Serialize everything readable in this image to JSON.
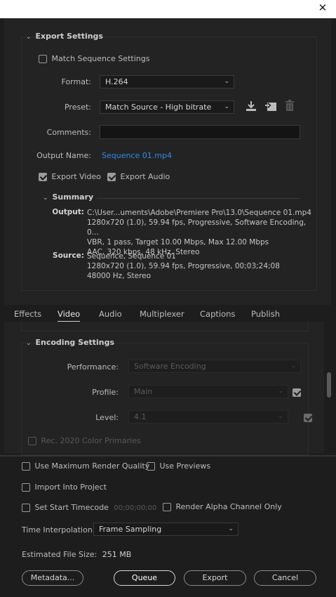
{
  "window": {
    "close_glyph": "✕"
  },
  "export_settings": {
    "header": "Export Settings",
    "match_sequence": {
      "label": "Match Sequence Settings",
      "checked": false
    },
    "format": {
      "label": "Format:",
      "value": "H.264"
    },
    "preset": {
      "label": "Preset:",
      "value": "Match Source - High bitrate"
    },
    "preset_icons": [
      "save-preset-icon",
      "import-preset-icon",
      "delete-preset-icon"
    ],
    "comments": {
      "label": "Comments:",
      "value": ""
    },
    "output_name": {
      "label": "Output Name:",
      "value": "Sequence 01.mp4"
    },
    "export_video": {
      "label": "Export Video",
      "checked": true
    },
    "export_audio": {
      "label": "Export Audio",
      "checked": true
    },
    "summary": {
      "header": "Summary",
      "output_label": "Output:",
      "output_lines": [
        "C:\\User...uments\\Adobe\\Premiere Pro\\13.0\\Sequence 01.mp4",
        "1280x720 (1.0), 59.94 fps, Progressive, Software Encoding, 0...",
        "VBR, 1 pass, Target 10.00 Mbps, Max 12.00 Mbps",
        "AAC, 320 kbps, 48 kHz, Stereo"
      ],
      "source_label": "Source:",
      "source_lines": [
        "Sequence, Sequence 01",
        "1280x720 (1.0), 59.94 fps, Progressive, 00;03;24;08",
        "48000 Hz, Stereo"
      ]
    }
  },
  "tabs": [
    "Effects",
    "Video",
    "Audio",
    "Multiplexer",
    "Captions",
    "Publish"
  ],
  "active_tab": "Video",
  "encoding_settings": {
    "header": "Encoding Settings",
    "performance": {
      "label": "Performance:",
      "value": "Software Encoding"
    },
    "profile": {
      "label": "Profile:",
      "value": "Main",
      "checked": true
    },
    "level": {
      "label": "Level:",
      "value": "4.1",
      "checked": true
    },
    "rec2020": {
      "label": "Rec. 2020 Color Primaries",
      "checked": false
    }
  },
  "bottom": {
    "max_render_quality": {
      "label": "Use Maximum Render Quality",
      "checked": false
    },
    "use_previews": {
      "label": "Use Previews",
      "checked": false
    },
    "import_into_project": {
      "label": "Import Into Project",
      "checked": false
    },
    "set_start_timecode": {
      "label": "Set Start Timecode",
      "checked": false,
      "value": "00;00;00;00"
    },
    "render_alpha": {
      "label": "Render Alpha Channel Only",
      "checked": false
    },
    "time_interpolation": {
      "label": "Time Interpolation:",
      "value": "Frame Sampling"
    },
    "estimated_file_size": {
      "label": "Estimated File Size:",
      "value": "251 MB"
    },
    "buttons": {
      "metadata": "Metadata...",
      "queue": "Queue",
      "export": "Export",
      "cancel": "Cancel"
    }
  },
  "colors": {
    "link": "#2d8ceb",
    "panel": "#232323",
    "background": "#1d1d1d"
  }
}
